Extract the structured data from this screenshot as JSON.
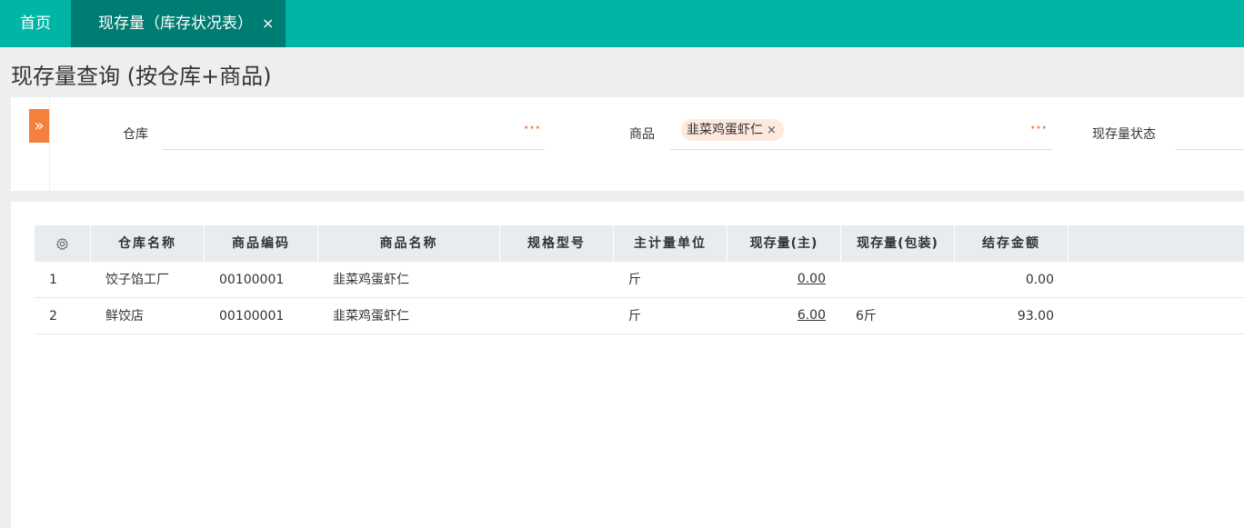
{
  "tabs": {
    "home_label": "首页",
    "active_label": "现存量（库存状况表）",
    "close_glyph": "×"
  },
  "page": {
    "title": "现存量查询 (按仓库+商品)"
  },
  "filters": {
    "expand_glyph": "»",
    "warehouse_label": "仓库",
    "warehouse_value": "",
    "product_label": "商品",
    "product_tag": "韭菜鸡蛋虾仁",
    "tag_close_glyph": "×",
    "status_label": "现存量状态",
    "dots": "···"
  },
  "table": {
    "settings_icon": "gear-icon",
    "headers": [
      "仓库名称",
      "商品编码",
      "商品名称",
      "规格型号",
      "主计量单位",
      "现存量(主)",
      "现存量(包装)",
      "结存金额"
    ],
    "rows": [
      {
        "index": "1",
        "warehouse": "饺子馅工厂",
        "code": "00100001",
        "name": "韭菜鸡蛋虾仁",
        "spec": "",
        "unit": "斤",
        "qty_main": "0.00",
        "qty_pack": "",
        "amount": "0.00"
      },
      {
        "index": "2",
        "warehouse": "鲜饺店",
        "code": "00100001",
        "name": "韭菜鸡蛋虾仁",
        "spec": "",
        "unit": "斤",
        "qty_main": "6.00",
        "qty_pack": "6斤",
        "amount": "93.00"
      }
    ]
  },
  "colors": {
    "tab_bar": "#00b5a6",
    "tab_active": "#007d73",
    "accent_orange": "#f5803e",
    "tag_bg": "#fde9dd",
    "header_bg": "#e9ecef"
  }
}
